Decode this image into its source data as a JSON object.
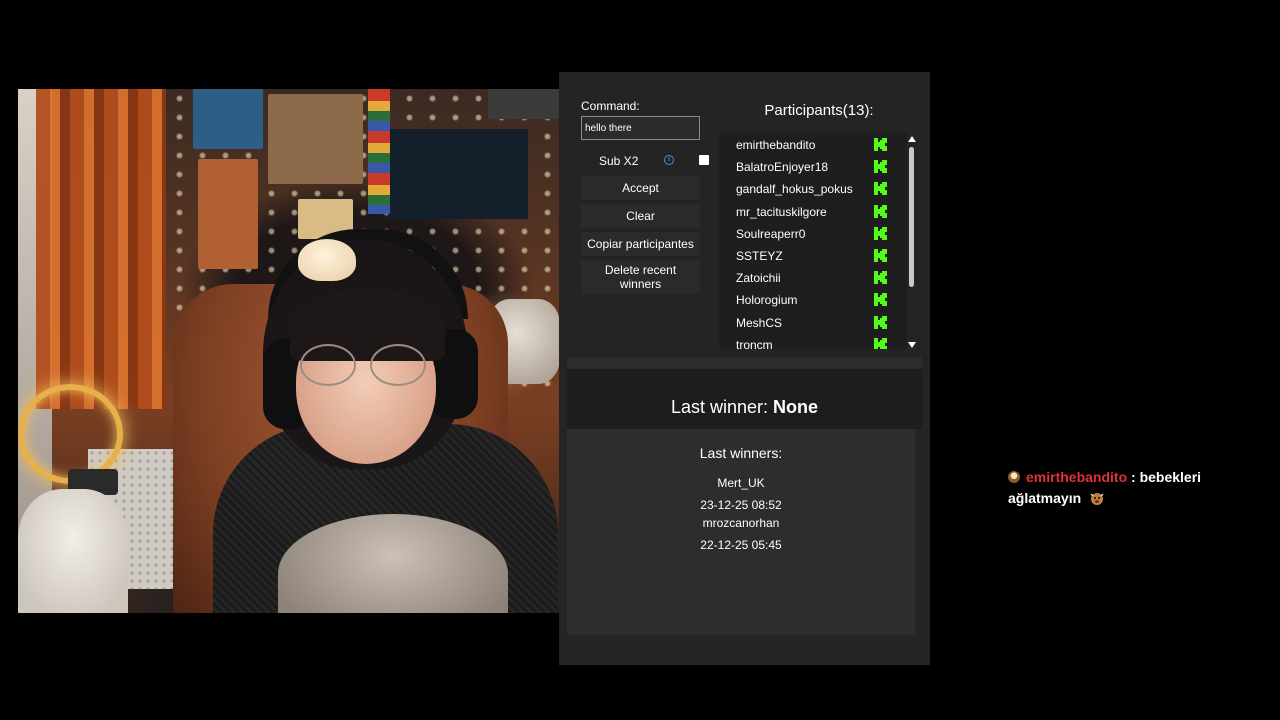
{
  "command": {
    "label": "Command:",
    "value": "hello there"
  },
  "sub": {
    "label": "Sub X2",
    "info_icon": "info-icon",
    "checked": false
  },
  "buttons": {
    "accept": "Accept",
    "clear": "Clear",
    "copy": "Copiar participantes",
    "delete": "Delete recent winners"
  },
  "participants": {
    "title": "Participants(13):",
    "platform_icon": "kick-icon",
    "platform_color": "#53fc18",
    "items": [
      {
        "name": "emirthebandito"
      },
      {
        "name": "BalatroEnjoyer18"
      },
      {
        "name": "gandalf_hokus_pokus"
      },
      {
        "name": "mr_tacituskilgore"
      },
      {
        "name": "Soulreaperr0"
      },
      {
        "name": "SSTEYZ"
      },
      {
        "name": "Zatoichii"
      },
      {
        "name": "Holorogium"
      },
      {
        "name": "MeshCS"
      },
      {
        "name": "troncm"
      }
    ]
  },
  "last_winner": {
    "label": "Last winner:",
    "value": "None"
  },
  "last_winners": {
    "title": "Last winners:",
    "entries": [
      {
        "name": "Mert_UK",
        "date": "23-12-25 08:52"
      },
      {
        "name": "mrozcanorhan",
        "date": "22-12-25 05:45"
      }
    ]
  },
  "chat": {
    "badge_icon": "badge-icon",
    "username": "emirthebandito",
    "username_color": "#e0323b",
    "separator": ":",
    "message_line1": "bebekleri",
    "message_line2": "ağlatmayın",
    "emote_icon": "crying-emote-icon"
  }
}
